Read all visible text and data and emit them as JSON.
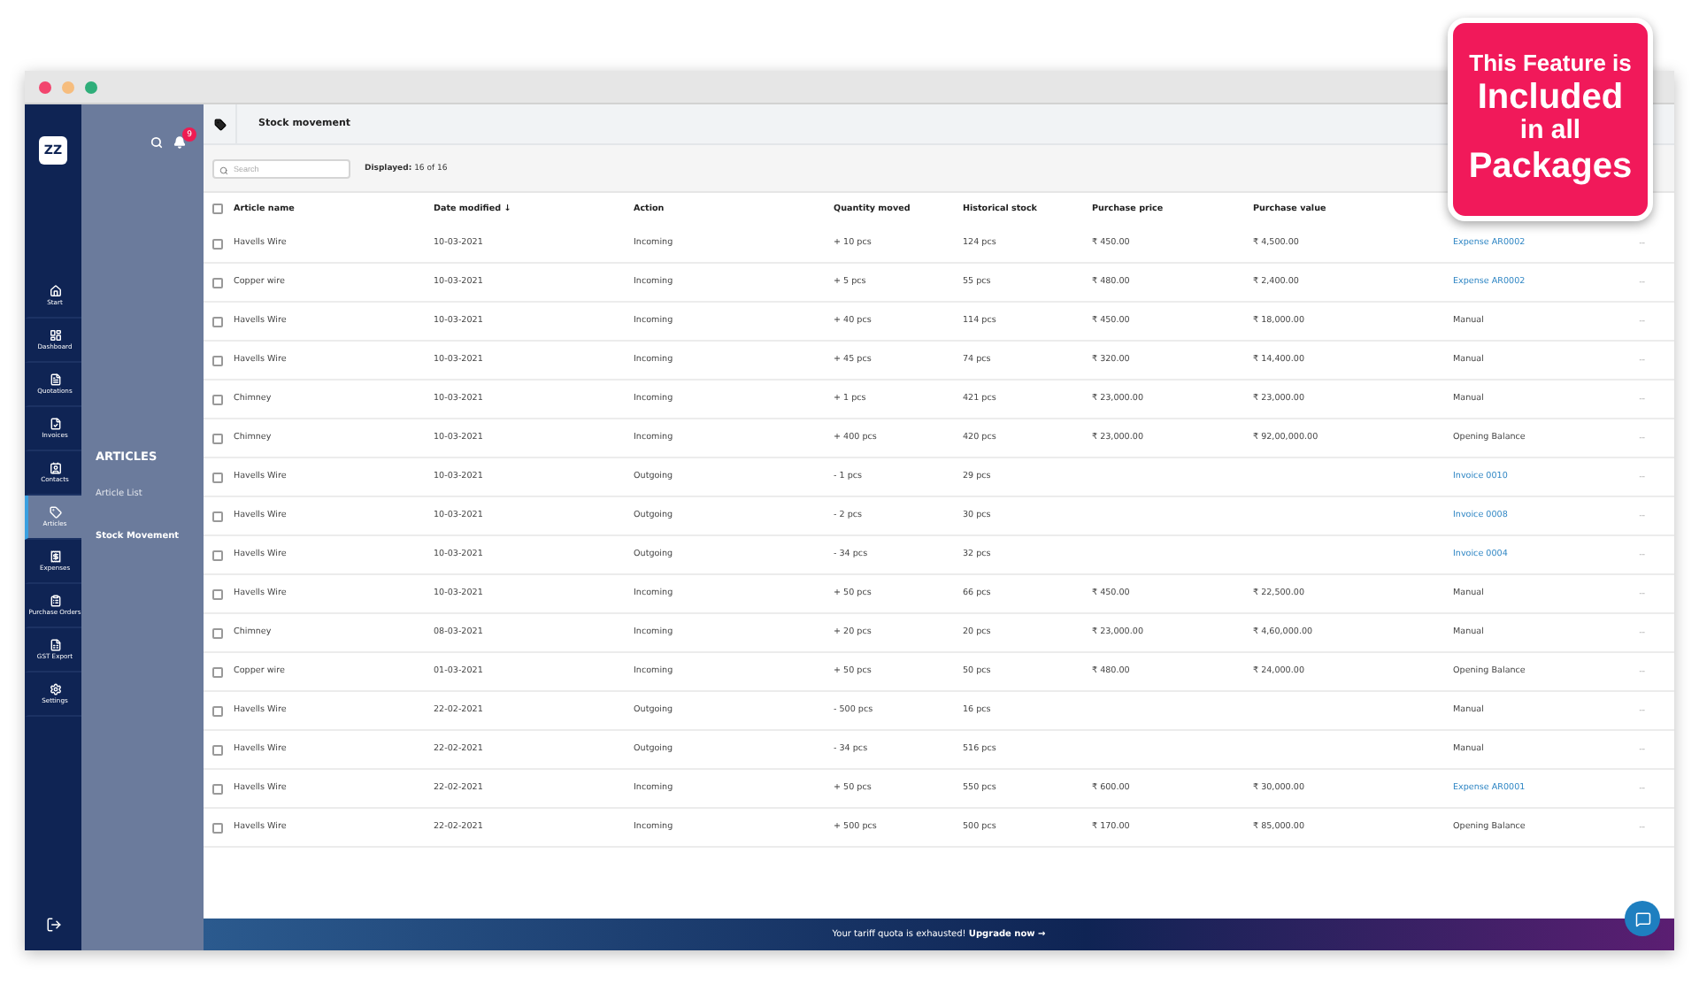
{
  "promo_badge": {
    "lines": [
      "This Feature is",
      "Included",
      "in all",
      "Packages"
    ]
  },
  "sidebar": {
    "logo": "ZZ",
    "items": [
      {
        "label": "Start",
        "selected": false
      },
      {
        "label": "Dashboard",
        "selected": false
      },
      {
        "label": "Quotations",
        "selected": false
      },
      {
        "label": "Invoices",
        "selected": false
      },
      {
        "label": "Contacts",
        "selected": false
      },
      {
        "label": "Articles",
        "selected": true
      },
      {
        "label": "Expenses",
        "selected": false
      },
      {
        "label": "Purchase Orders",
        "selected": false
      },
      {
        "label": "GST Export",
        "selected": false
      },
      {
        "label": "Settings",
        "selected": false
      }
    ]
  },
  "subpanel": {
    "notification_count": "9",
    "title": "ARTICLES",
    "items": [
      {
        "label": "Article List",
        "selected": false
      },
      {
        "label": "Stock Movement",
        "selected": true
      }
    ]
  },
  "header": {
    "title": "Stock movement"
  },
  "toolbar": {
    "search_placeholder": "Search",
    "displayed_label": "Displayed:",
    "displayed_value": "16 of 16"
  },
  "table": {
    "select_all_checked": false,
    "columns": [
      "Article name",
      "Date modified ↓",
      "Action",
      "Quantity moved",
      "Historical stock",
      "Purchase price",
      "Purchase value"
    ],
    "rows": [
      {
        "checked": false,
        "cells": [
          "Havells Wire",
          "10-03-2021",
          "Incoming",
          "+ 10 pcs",
          "124 pcs",
          "₹ 450.00",
          "₹ 4,500.00"
        ],
        "source": {
          "kind": "link",
          "text": "Expense AR0002"
        },
        "more": "···"
      },
      {
        "checked": false,
        "cells": [
          "Copper wire",
          "10-03-2021",
          "Incoming",
          "+ 5 pcs",
          "55 pcs",
          "₹ 480.00",
          "₹ 2,400.00"
        ],
        "source": {
          "kind": "link",
          "text": "Expense AR0002"
        },
        "more": "···"
      },
      {
        "checked": false,
        "cells": [
          "Havells Wire",
          "10-03-2021",
          "Incoming",
          "+ 40 pcs",
          "114 pcs",
          "₹ 450.00",
          "₹ 18,000.00"
        ],
        "source": {
          "kind": "text",
          "text": "Manual"
        },
        "more": "···"
      },
      {
        "checked": false,
        "cells": [
          "Havells Wire",
          "10-03-2021",
          "Incoming",
          "+ 45 pcs",
          "74 pcs",
          "₹ 320.00",
          "₹ 14,400.00"
        ],
        "source": {
          "kind": "text",
          "text": "Manual"
        },
        "more": "···"
      },
      {
        "checked": false,
        "cells": [
          "Chimney",
          "10-03-2021",
          "Incoming",
          "+ 1 pcs",
          "421 pcs",
          "₹ 23,000.00",
          "₹ 23,000.00"
        ],
        "source": {
          "kind": "text",
          "text": "Manual"
        },
        "more": "···"
      },
      {
        "checked": false,
        "cells": [
          "Chimney",
          "10-03-2021",
          "Incoming",
          "+ 400 pcs",
          "420 pcs",
          "₹ 23,000.00",
          "₹ 92,00,000.00"
        ],
        "source": {
          "kind": "text",
          "text": "Opening Balance"
        },
        "more": "···"
      },
      {
        "checked": false,
        "cells": [
          "Havells Wire",
          "10-03-2021",
          "Outgoing",
          "- 1 pcs",
          "29 pcs",
          "",
          ""
        ],
        "source": {
          "kind": "link",
          "text": "Invoice 0010"
        },
        "more": "···"
      },
      {
        "checked": false,
        "cells": [
          "Havells Wire",
          "10-03-2021",
          "Outgoing",
          "- 2 pcs",
          "30 pcs",
          "",
          ""
        ],
        "source": {
          "kind": "link",
          "text": "Invoice 0008"
        },
        "more": "···"
      },
      {
        "checked": false,
        "cells": [
          "Havells Wire",
          "10-03-2021",
          "Outgoing",
          "- 34 pcs",
          "32 pcs",
          "",
          ""
        ],
        "source": {
          "kind": "link",
          "text": "Invoice 0004"
        },
        "more": "···"
      },
      {
        "checked": false,
        "cells": [
          "Havells Wire",
          "10-03-2021",
          "Incoming",
          "+ 50 pcs",
          "66 pcs",
          "₹ 450.00",
          "₹ 22,500.00"
        ],
        "source": {
          "kind": "text",
          "text": "Manual"
        },
        "more": "···"
      },
      {
        "checked": false,
        "cells": [
          "Chimney",
          "08-03-2021",
          "Incoming",
          "+ 20 pcs",
          "20 pcs",
          "₹ 23,000.00",
          "₹ 4,60,000.00"
        ],
        "source": {
          "kind": "text",
          "text": "Manual"
        },
        "more": "···"
      },
      {
        "checked": false,
        "cells": [
          "Copper wire",
          "01-03-2021",
          "Incoming",
          "+ 50 pcs",
          "50 pcs",
          "₹ 480.00",
          "₹ 24,000.00"
        ],
        "source": {
          "kind": "text",
          "text": "Opening Balance"
        },
        "more": "···"
      },
      {
        "checked": false,
        "cells": [
          "Havells Wire",
          "22-02-2021",
          "Outgoing",
          "- 500 pcs",
          "16 pcs",
          "",
          ""
        ],
        "source": {
          "kind": "text",
          "text": "Manual"
        },
        "more": "···"
      },
      {
        "checked": false,
        "cells": [
          "Havells Wire",
          "22-02-2021",
          "Outgoing",
          "- 34 pcs",
          "516 pcs",
          "",
          ""
        ],
        "source": {
          "kind": "text",
          "text": "Manual"
        },
        "more": "···"
      },
      {
        "checked": false,
        "cells": [
          "Havells Wire",
          "22-02-2021",
          "Incoming",
          "+ 50 pcs",
          "550 pcs",
          "₹ 600.00",
          "₹ 30,000.00"
        ],
        "source": {
          "kind": "link",
          "text": "Expense AR0001"
        },
        "more": "···"
      },
      {
        "checked": false,
        "cells": [
          "Havells Wire",
          "22-02-2021",
          "Incoming",
          "+ 500 pcs",
          "500 pcs",
          "₹ 170.00",
          "₹ 85,000.00"
        ],
        "source": {
          "kind": "text",
          "text": "Opening Balance"
        },
        "more": "···"
      }
    ]
  },
  "banner": {
    "text": "Your tariff quota is exhausted! **Upgrade now →**"
  }
}
